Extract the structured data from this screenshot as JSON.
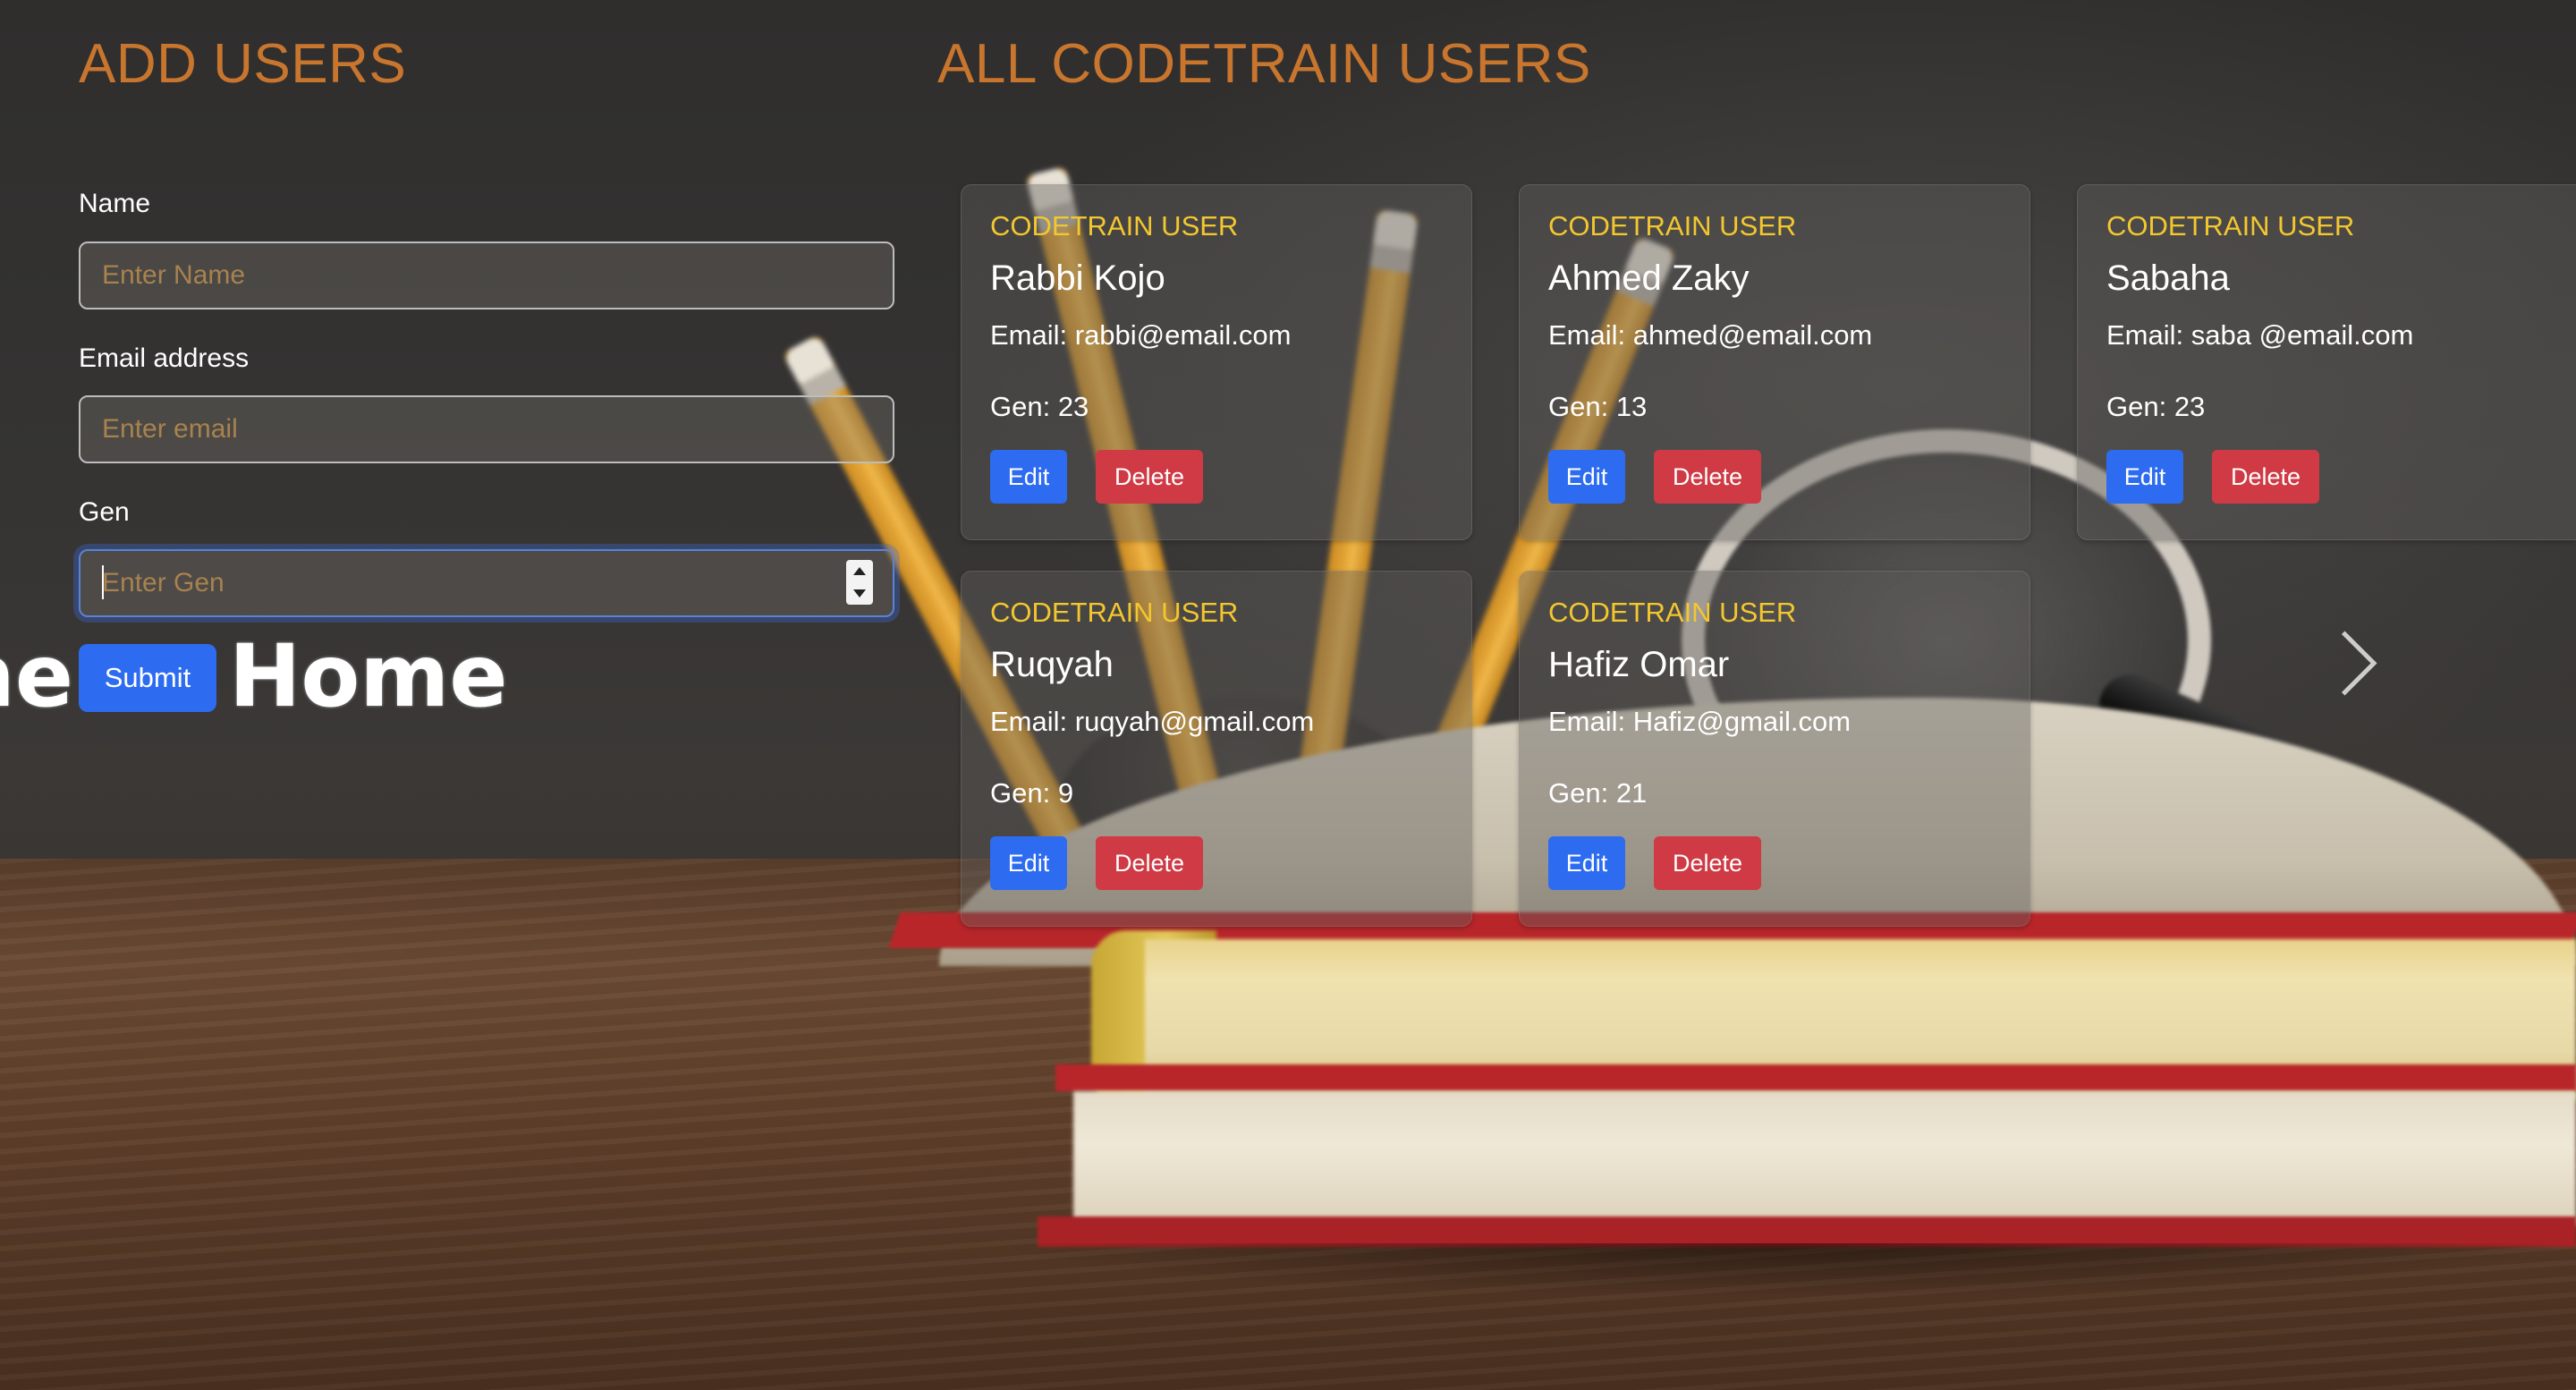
{
  "headings": {
    "add_users": "ADD USERS",
    "all_users": "ALL CODETRAIN USERS"
  },
  "form": {
    "name_label": "Name",
    "name_placeholder": "Enter Name",
    "email_label": "Email address",
    "email_placeholder": "Enter email",
    "gen_label": "Gen",
    "gen_placeholder": "Enter Gen",
    "submit_label": "Submit"
  },
  "overlay_text": {
    "fragment": "me",
    "home": "Home"
  },
  "users": [
    {
      "tag": "CODETRAIN USER",
      "name": "Rabbi Kojo",
      "email": "Email: rabbi@email.com",
      "gen": "Gen: 23",
      "edit": "Edit",
      "delete": "Delete"
    },
    {
      "tag": "CODETRAIN USER",
      "name": "Ahmed Zaky",
      "email": "Email: ahmed@email.com",
      "gen": "Gen: 13",
      "edit": "Edit",
      "delete": "Delete"
    },
    {
      "tag": "CODETRAIN USER",
      "name": "Sabaha",
      "email": "Email: saba @email.com",
      "gen": "Gen: 23",
      "edit": "Edit",
      "delete": "Delete"
    },
    {
      "tag": "CODETRAIN USER",
      "name": "Ruqyah",
      "email": "Email: ruqyah@gmail.com",
      "gen": "Gen: 9",
      "edit": "Edit",
      "delete": "Delete"
    },
    {
      "tag": "CODETRAIN USER",
      "name": "Hafiz Omar",
      "email": "Email: Hafiz@gmail.com",
      "gen": "Gen: 21",
      "edit": "Edit",
      "delete": "Delete"
    }
  ],
  "icons": {
    "carousel_next": "chevron-right-icon"
  },
  "colors": {
    "heading": "#c8752e",
    "tag": "#f3c72e",
    "primary_button": "#2d6cf0",
    "danger_button": "#cf3a44"
  }
}
